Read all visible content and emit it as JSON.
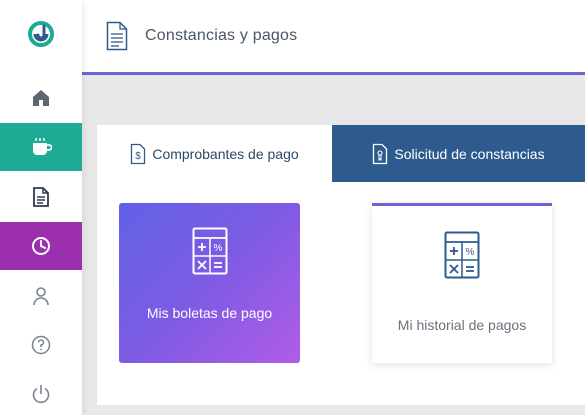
{
  "header": {
    "title": "Constancias y pagos"
  },
  "sidebar": {
    "items": [
      {
        "icon": "home-icon"
      },
      {
        "icon": "coffee-icon",
        "active_color": "#1faa96"
      },
      {
        "icon": "document-icon"
      },
      {
        "icon": "clock-icon",
        "active_color": "#9b2fae"
      },
      {
        "icon": "user-icon"
      },
      {
        "icon": "help-icon"
      },
      {
        "icon": "power-icon"
      }
    ]
  },
  "tabs": [
    {
      "label": "Comprobantes de pago",
      "icon": "dollar-document-icon",
      "selected": true
    },
    {
      "label": "Solicitud de constancias",
      "icon": "certificate-icon",
      "selected": false
    }
  ],
  "cards": [
    {
      "label": "Mis boletas de pago",
      "icon": "calculator-icon"
    },
    {
      "label": "Mi historial de pagos",
      "icon": "calculator-icon"
    }
  ],
  "colors": {
    "accent": "#6a68d8",
    "tab_active_bg": "#2d5b8e",
    "teal": "#1faa96",
    "purple": "#9b2fae"
  }
}
